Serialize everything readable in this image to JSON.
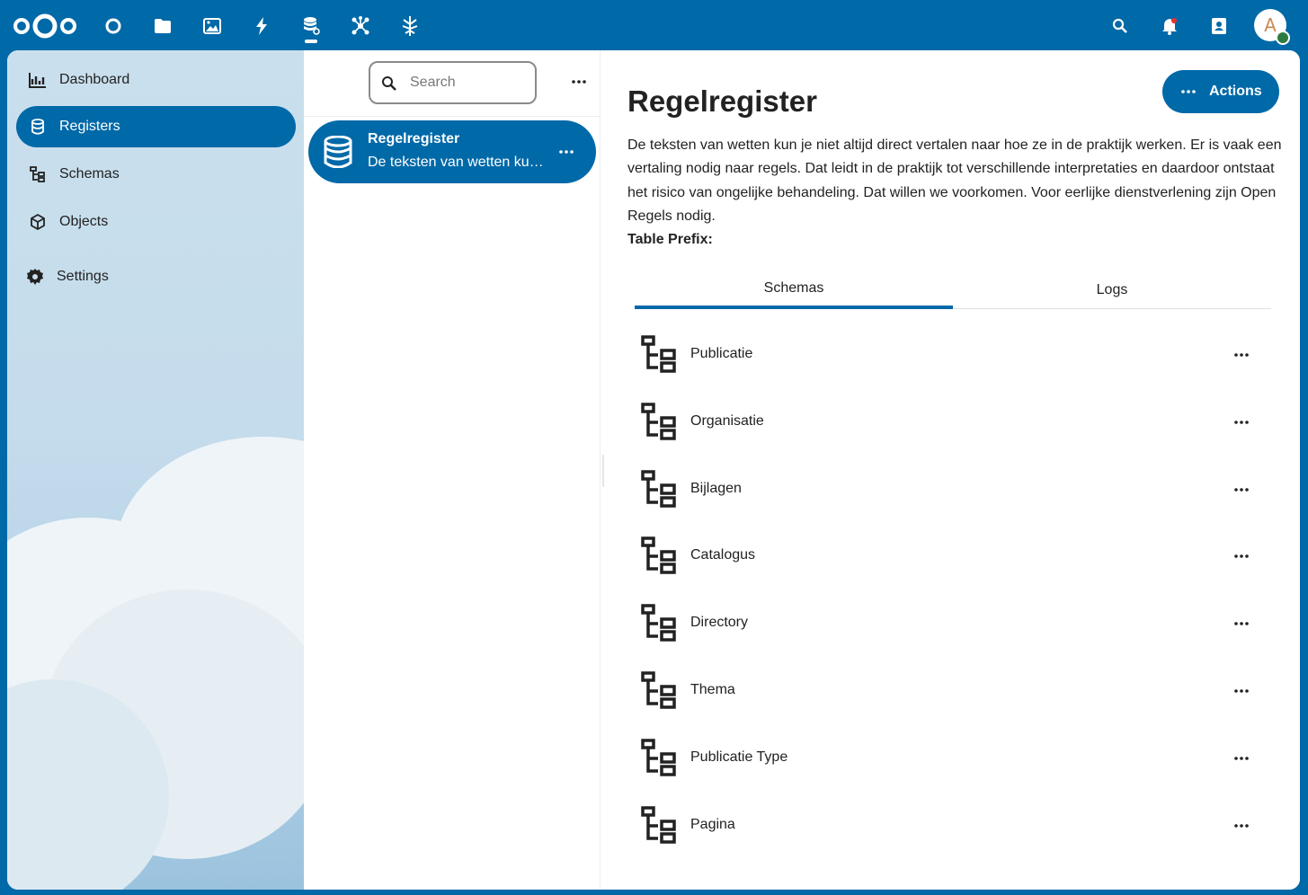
{
  "header": {
    "apps": [
      {
        "name": "dashboard-app",
        "icon": "circle-icon"
      },
      {
        "name": "files-app",
        "icon": "folder-icon"
      },
      {
        "name": "photos-app",
        "icon": "image-icon"
      },
      {
        "name": "activity-app",
        "icon": "lightning-icon"
      },
      {
        "name": "openregister-app",
        "icon": "database-icon"
      },
      {
        "name": "openconnector-app",
        "icon": "network-icon"
      },
      {
        "name": "opencatalogi-app",
        "icon": "tree-icon"
      }
    ],
    "avatar_letter": "A",
    "accent_color": "#0069a8"
  },
  "sidebar": {
    "items": [
      {
        "label": "Dashboard",
        "icon": "chart-icon"
      },
      {
        "label": "Registers",
        "icon": "database-icon",
        "active": true
      },
      {
        "label": "Schemas",
        "icon": "schema-icon"
      },
      {
        "label": "Objects",
        "icon": "cube-icon"
      },
      {
        "label": "Settings",
        "icon": "gear-icon"
      }
    ]
  },
  "list": {
    "search_placeholder": "Search",
    "entries": [
      {
        "title": "Regelregister",
        "subtitle": "De teksten van wetten kun je niet altijd direct vertalen"
      }
    ]
  },
  "detail": {
    "title": "Regelregister",
    "actions_label": "Actions",
    "description": "De teksten van wetten kun je niet altijd direct vertalen naar hoe ze in de praktijk werken. Er is vaak een vertaling nodig naar regels. Dat leidt in de praktijk tot verschillende interpretaties en daardoor ontstaat het risico van ongelijke behandeling. Dat willen we voorkomen. Voor eerlijke dienstverlening zijn Open Regels nodig.",
    "table_prefix_label": "Table Prefix:",
    "tabs": [
      {
        "label": "Schemas",
        "active": true
      },
      {
        "label": "Logs",
        "active": false
      }
    ],
    "schemas": [
      {
        "name": "Publicatie"
      },
      {
        "name": "Organisatie"
      },
      {
        "name": "Bijlagen"
      },
      {
        "name": "Catalogus"
      },
      {
        "name": "Directory"
      },
      {
        "name": "Thema"
      },
      {
        "name": "Publicatie Type"
      },
      {
        "name": "Pagina"
      }
    ]
  }
}
